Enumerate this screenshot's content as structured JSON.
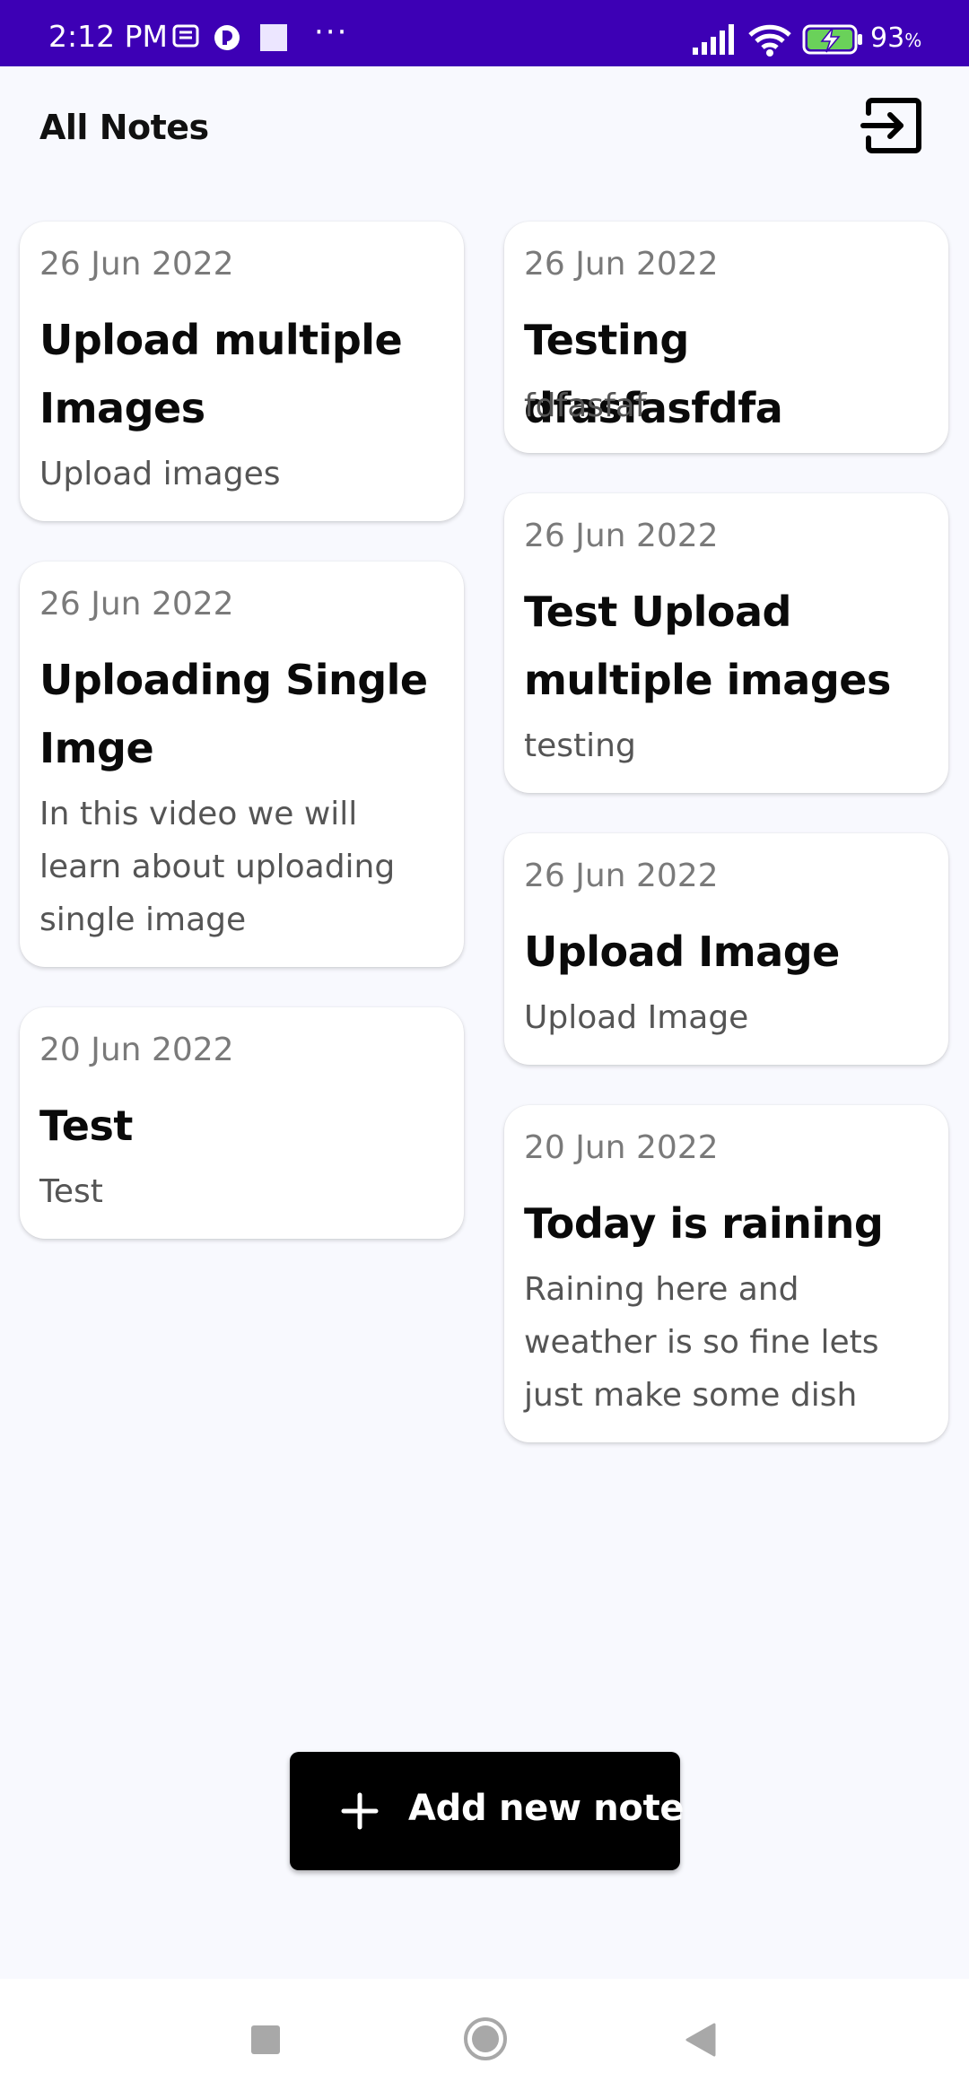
{
  "status_bar": {
    "time": "2:12 PM",
    "battery": "93",
    "battery_unit": "%",
    "icons": [
      "notes-icon",
      "app-icon",
      "square-icon",
      "more-dots-icon",
      "signal-icon",
      "wifi-icon",
      "battery-charging-icon"
    ],
    "more": "···"
  },
  "header": {
    "title": "All Notes",
    "logout_icon": "logout-icon"
  },
  "notes": [
    {
      "date": "26 Jun 2022",
      "title": "Upload multiple Images",
      "body": "Upload images"
    },
    {
      "date": "26 Jun 2022",
      "title": "Testing dfasfasfdfa",
      "body": "fdfasfaf"
    },
    {
      "date": "26 Jun 2022",
      "title": "Uploading Single Imge",
      "body": "In this video we will learn about uploading single image"
    },
    {
      "date": "26 Jun 2022",
      "title": "Test Upload multiple images",
      "body": "testing"
    },
    {
      "date": "20 Jun 2022",
      "title": "Test",
      "body": "Test"
    },
    {
      "date": "26 Jun 2022",
      "title": "Upload Image",
      "body": "Upload Image"
    },
    {
      "date": "20 Jun 2022",
      "title": "Today is raining",
      "body": "Raining here and weather is so fine lets just make some dish"
    }
  ],
  "fab": {
    "label": "Add new note",
    "icon": "plus-icon"
  },
  "nav_bar": {
    "icons": [
      "recents-icon",
      "home-icon",
      "back-icon"
    ]
  },
  "colors": {
    "status_bar": "#3d00b5",
    "background": "#f8f9fe",
    "fab": "#000000"
  }
}
